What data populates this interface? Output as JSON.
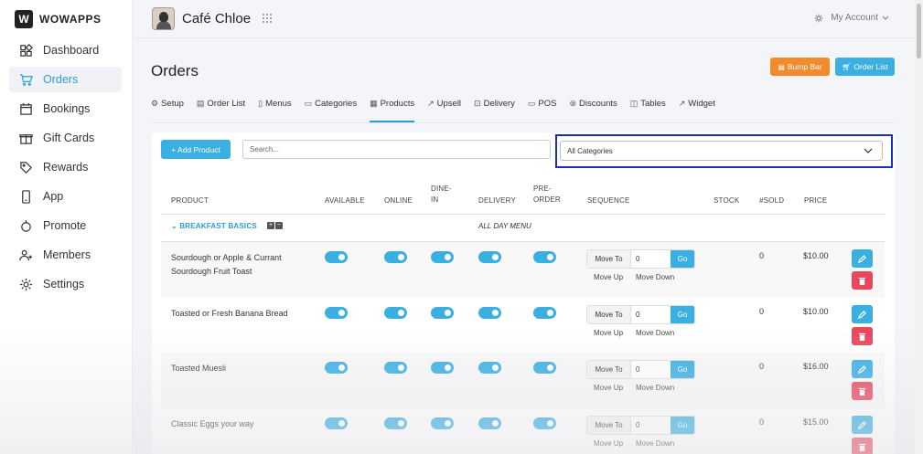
{
  "brand": {
    "logo_letter": "W",
    "name": "WOWAPPS"
  },
  "sidebar": {
    "items": [
      {
        "label": "Dashboard",
        "icon": "dashboard-icon",
        "active": false
      },
      {
        "label": "Orders",
        "icon": "cart-icon",
        "active": true
      },
      {
        "label": "Bookings",
        "icon": "calendar-icon",
        "active": false
      },
      {
        "label": "Gift Cards",
        "icon": "gift-icon",
        "active": false
      },
      {
        "label": "Rewards",
        "icon": "tag-icon",
        "active": false
      },
      {
        "label": "App",
        "icon": "phone-icon",
        "active": false
      },
      {
        "label": "Promote",
        "icon": "promote-icon",
        "active": false
      },
      {
        "label": "Members",
        "icon": "members-icon",
        "active": false
      },
      {
        "label": "Settings",
        "icon": "gear-icon",
        "active": false
      }
    ]
  },
  "topbar": {
    "store_name": "Café Chloe",
    "account_label": "My Account"
  },
  "page": {
    "title": "Orders",
    "bump_bar_label": "Bump Bar",
    "order_list_label": "Order List"
  },
  "tabs": [
    {
      "label": "Setup",
      "icon": "⚙"
    },
    {
      "label": "Order List",
      "icon": "▤"
    },
    {
      "label": "Menus",
      "icon": "▯"
    },
    {
      "label": "Categories",
      "icon": "▭"
    },
    {
      "label": "Products",
      "icon": "▦",
      "active": true
    },
    {
      "label": "Upsell",
      "icon": "↗"
    },
    {
      "label": "Delivery",
      "icon": "⊡"
    },
    {
      "label": "POS",
      "icon": "▭"
    },
    {
      "label": "Discounts",
      "icon": "⊛"
    },
    {
      "label": "Tables",
      "icon": "◫"
    },
    {
      "label": "Widget",
      "icon": "↗"
    }
  ],
  "toolbar": {
    "add_product_label": "+ Add Product",
    "search_placeholder": "Search...",
    "category_value": "All Categories"
  },
  "table": {
    "headers": {
      "product": "PRODUCT",
      "available": "AVAILABLE",
      "online": "ONLINE",
      "dine_in_1": "DINE-",
      "dine_in_2": "IN",
      "delivery": "DELIVERY",
      "pre_order_1": "PRE-",
      "pre_order_2": "ORDER",
      "sequence": "SEQUENCE",
      "stock": "STOCK",
      "sold": "#SOLD",
      "price": "PRICE"
    },
    "group": {
      "name": "BREAKFAST BASICS",
      "menu": "ALL DAY MENU"
    },
    "sequence_labels": {
      "move_to": "Move To",
      "go": "Go",
      "move_up": "Move Up",
      "move_down": "Move Down"
    },
    "rows": [
      {
        "name": "Sourdough or Apple & Currant Sourdough Fruit Toast",
        "position": "0",
        "sold": "0",
        "price": "$10.00"
      },
      {
        "name": "Toasted or Fresh Banana Bread",
        "position": "0",
        "sold": "0",
        "price": "$10.00"
      },
      {
        "name": "Toasted Muesli",
        "position": "0",
        "sold": "0",
        "price": "$16.00"
      },
      {
        "name": "Classic Eggs your way",
        "position": "0",
        "sold": "0",
        "price": "$15.00"
      }
    ]
  },
  "colors": {
    "accent": "#3ab0e2",
    "orange": "#f28b2b",
    "danger": "#e8475d",
    "highlight_border": "#1a2ebd"
  }
}
